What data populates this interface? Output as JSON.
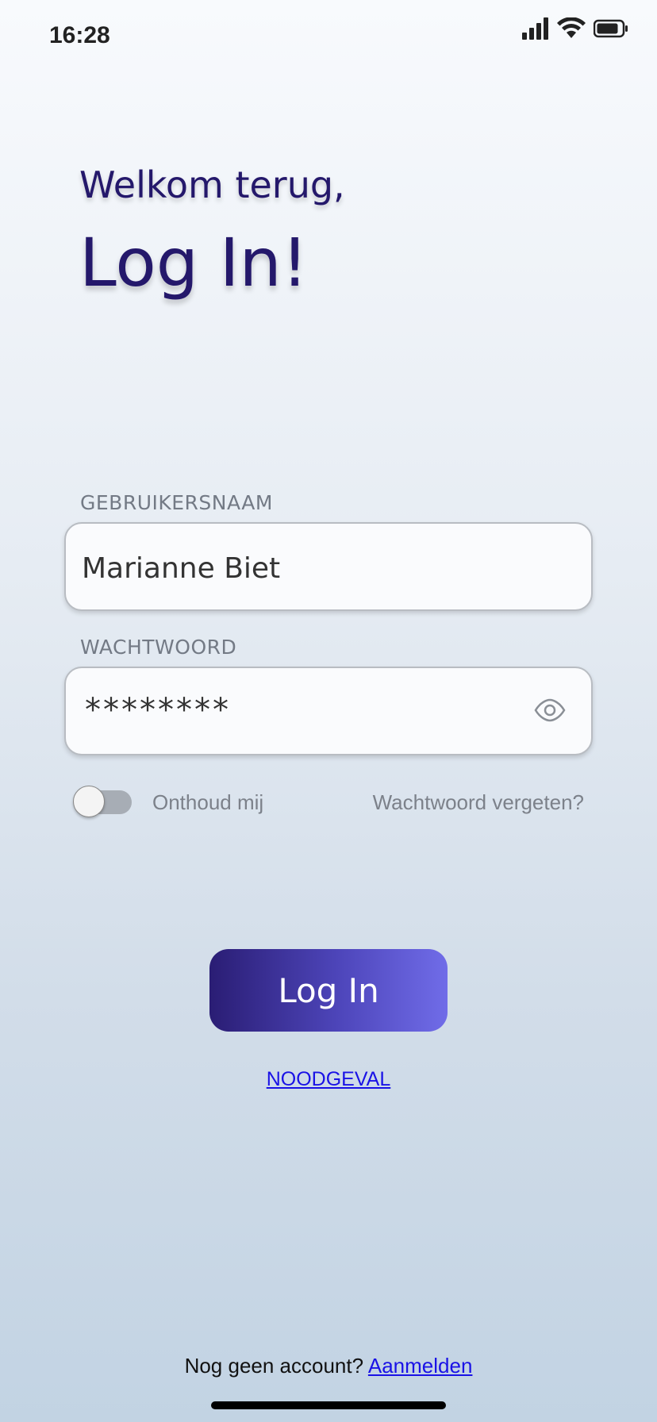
{
  "status_bar": {
    "time": "16:28",
    "icons": [
      "cellular-signal-icon",
      "wifi-icon",
      "battery-icon"
    ]
  },
  "header": {
    "greeting": "Welkom terug,",
    "title": "Log In!"
  },
  "form": {
    "username": {
      "label": "GEBRUIKERSNAAM",
      "value": "Marianne Biet"
    },
    "password": {
      "label": "WACHTWOORD",
      "masked_value": "********",
      "reveal_icon": "eye-icon"
    },
    "remember_me": {
      "label": "Onthoud mij",
      "checked": false
    },
    "forgot_password": "Wachtwoord vergeten?"
  },
  "actions": {
    "login_label": "Log In",
    "emergency_label": "NOODGEVAL"
  },
  "footer": {
    "no_account_text": "Nog geen account?",
    "signup_label": "Aanmelden"
  },
  "colors": {
    "title": "#24186b",
    "button_gradient_start": "#2a1d74",
    "button_gradient_end": "#706ce8",
    "link": "#1a12e6"
  }
}
